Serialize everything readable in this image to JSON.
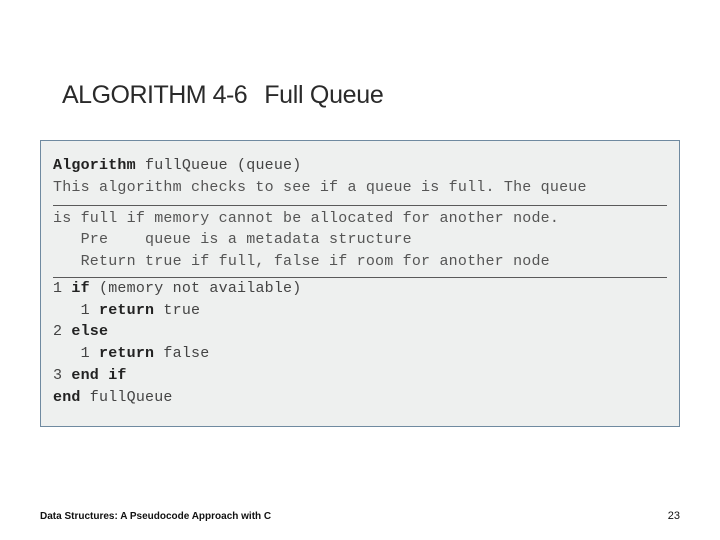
{
  "heading": {
    "label": "ALGORITHM 4-6",
    "title": "Full Queue"
  },
  "code": {
    "l0a": "Algorithm",
    "l0b": " fullQueue (queue)",
    "l1": "This algorithm checks to see if a queue is full. The queue",
    "l2": "is full if memory cannot be allocated for another node.",
    "l3": "   Pre    queue is a metadata structure",
    "l4": "   Return true if full, false if room for another node",
    "l5a": "1 ",
    "l5b": "if",
    "l5c": " (memory not available)",
    "l6a": "   1 ",
    "l6b": "return",
    "l6c": " true",
    "l7a": "2 ",
    "l7b": "else",
    "l8a": "   1 ",
    "l8b": "return",
    "l8c": " false",
    "l9a": "3 ",
    "l9b": "end if",
    "l10a": "end",
    "l10b": " fullQueue"
  },
  "footer": {
    "left": "Data Structures: A Pseudocode Approach with C",
    "right": "23"
  }
}
